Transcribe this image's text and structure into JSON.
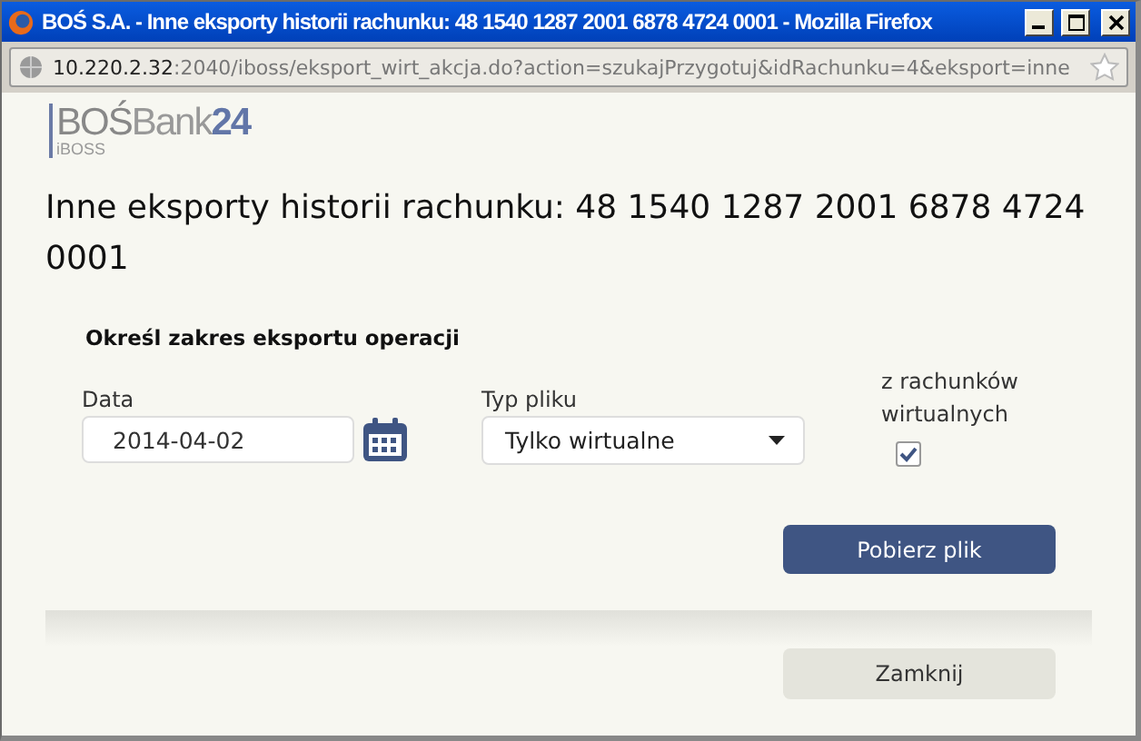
{
  "window": {
    "title": "BOŚ S.A. - Inne eksporty historii rachunku: 48 1540 1287 2001 6878 4724 0001 - Mozilla Firefox"
  },
  "address_bar": {
    "host": "10.220.2.32",
    "path": ":2040/iboss/eksport_wirt_akcja.do?action=szukajPrzygotuj&idRachunku=4&eksport=inne"
  },
  "logo": {
    "brand": "BOŚ",
    "name": "Bank",
    "number": "24",
    "sub": "iBOSS"
  },
  "heading": "Inne eksporty historii rachunku: 48 1540 1287 2001 6878 4724 0001",
  "section_title": "Określ zakres eksportu operacji",
  "date_field": {
    "label": "Data",
    "value": "2014-04-02"
  },
  "file_type": {
    "label": "Typ pliku",
    "value": "Tylko wirtualne"
  },
  "virtual_accounts": {
    "label": "z rachunków wirtualnych",
    "checked": true
  },
  "buttons": {
    "download": "Pobierz plik",
    "close": "Zamknij"
  }
}
